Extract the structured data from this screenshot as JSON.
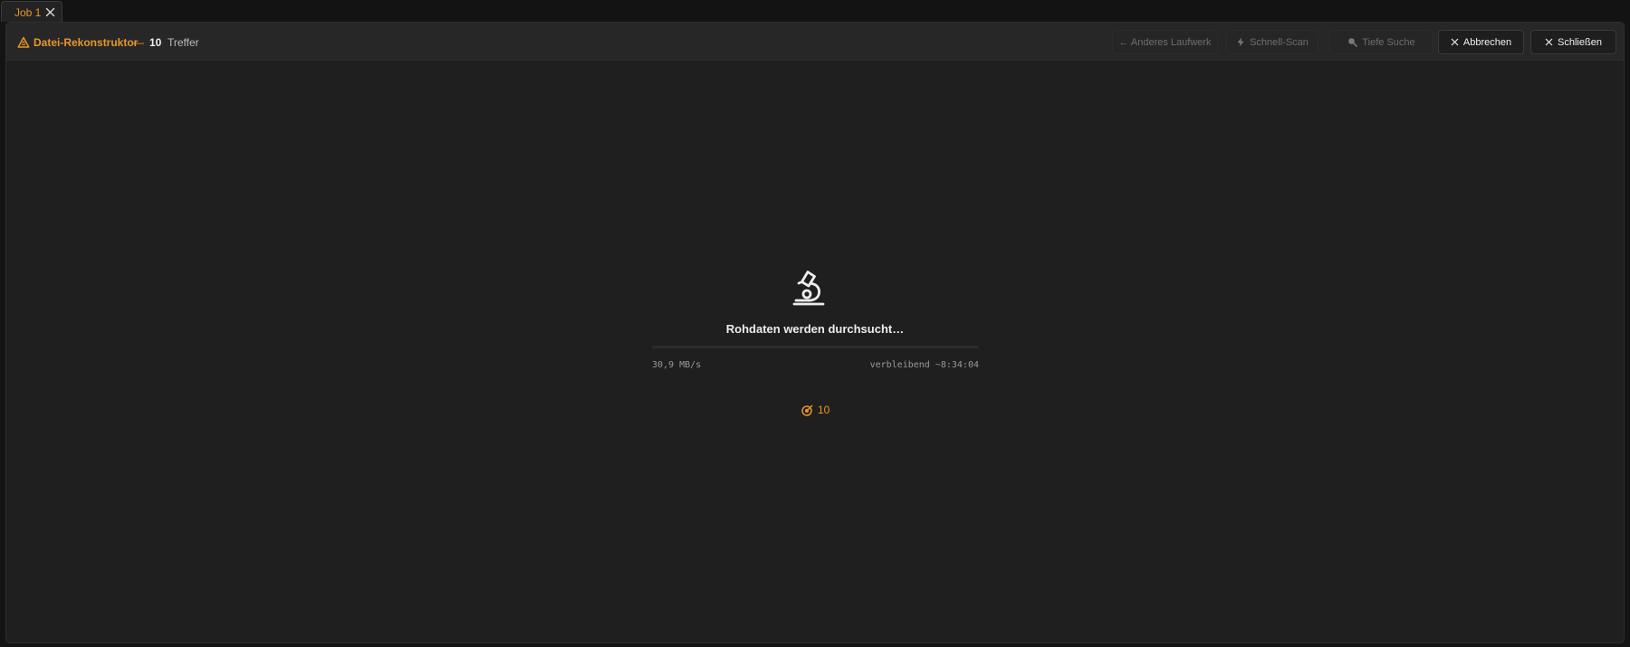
{
  "tabs": [
    {
      "label": "Job 1"
    }
  ],
  "header": {
    "title": "Datei-Rekonstruktor",
    "separator": "—",
    "hit_count": "10",
    "hit_unit": "Treffer"
  },
  "toolbar": {
    "other_drive_label": "← Anderes Laufwerk",
    "quick_scan_label": "Schnell-Scan",
    "deep_search_label": "Tiefe Suche",
    "abort_label": "Abbrechen",
    "close_label": "Schließen"
  },
  "scan": {
    "status_text": "Rohdaten werden durchsucht…",
    "progress_fraction": 0,
    "speed": "30,9 MB/s",
    "remaining": "verbleibend ~8:34:04",
    "hits": "10"
  },
  "colors": {
    "accent": "#e8962a",
    "background": "#1f1f1f"
  },
  "icons": {
    "title": "recycle-warning-icon",
    "quick_scan": "lightning-icon",
    "deep_search": "magnifier-icon",
    "center": "microscope-icon",
    "hits": "target-icon"
  }
}
